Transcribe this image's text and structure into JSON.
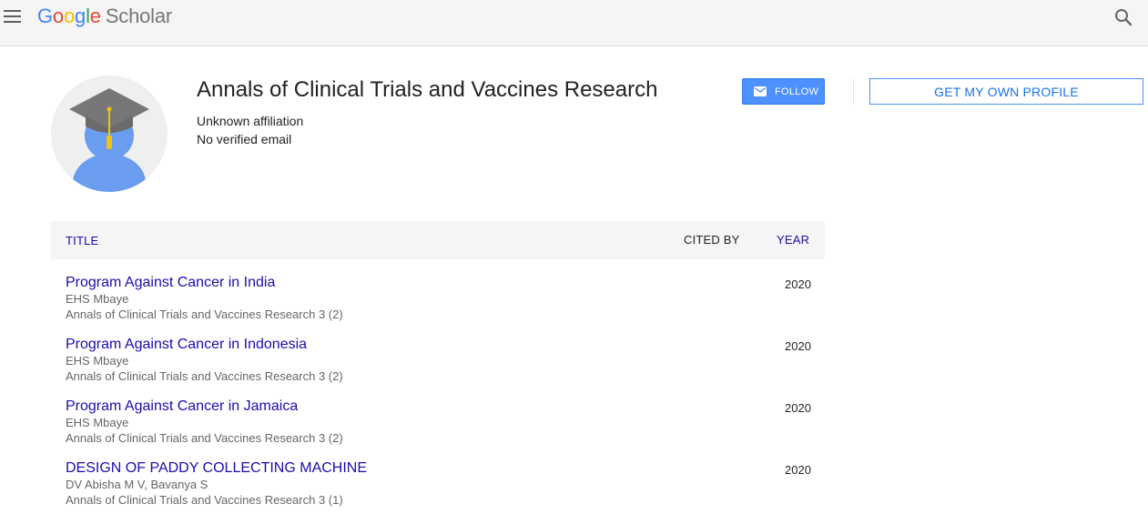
{
  "header": {
    "logo_letters": [
      "G",
      "o",
      "o",
      "g",
      "l",
      "e"
    ],
    "logo_suffix": "Scholar"
  },
  "profile": {
    "name": "Annals of Clinical Trials and Vaccines Research",
    "affiliation": "Unknown affiliation",
    "email_status": "No verified email",
    "follow_label": "FOLLOW",
    "own_profile_label": "GET MY OWN PROFILE"
  },
  "table": {
    "col_title": "TITLE",
    "col_cited": "CITED BY",
    "col_year": "YEAR"
  },
  "articles": [
    {
      "title": "Program Against Cancer in India",
      "authors": "EHS Mbaye",
      "venue": "Annals of Clinical Trials and Vaccines Research 3 (2)",
      "cited_by": "",
      "year": "2020"
    },
    {
      "title": "Program Against Cancer in Indonesia",
      "authors": "EHS Mbaye",
      "venue": "Annals of Clinical Trials and Vaccines Research 3 (2)",
      "cited_by": "",
      "year": "2020"
    },
    {
      "title": "Program Against Cancer in Jamaica",
      "authors": "EHS Mbaye",
      "venue": "Annals of Clinical Trials and Vaccines Research 3 (2)",
      "cited_by": "",
      "year": "2020"
    },
    {
      "title": "DESIGN OF PADDY COLLECTING MACHINE",
      "authors": "DV Abisha M V, Bavanya S",
      "venue": "Annals of Clinical Trials and Vaccines Research 3 (1)",
      "cited_by": "",
      "year": "2020"
    }
  ],
  "colors": {
    "link": "#1a0dab",
    "follow_bg": "#4d90fe",
    "topbar_bg": "#f5f5f5",
    "google_blue": "#4285f4",
    "google_red": "#ea4335",
    "google_yellow": "#fbbc05",
    "google_green": "#34a853"
  },
  "icons": {
    "menu": "hamburger-menu-icon",
    "search": "search-icon",
    "follow": "mail-icon",
    "avatar": "graduate-avatar-icon"
  }
}
